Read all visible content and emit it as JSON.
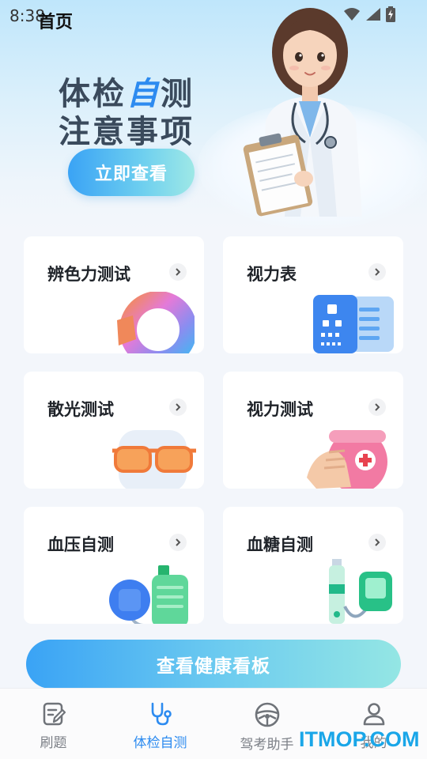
{
  "status_bar": {
    "time": "8:38"
  },
  "header": {
    "title": "首页"
  },
  "hero": {
    "title_line1_pre": "体检",
    "title_line1_accent": "自",
    "title_line1_post": "测",
    "title_line2": "注意事项",
    "cta_label": "立即查看"
  },
  "cards": [
    {
      "title": "辨色力测试",
      "illustration": "color-ring-icon"
    },
    {
      "title": "视力表",
      "illustration": "eye-chart-icon"
    },
    {
      "title": "散光测试",
      "illustration": "glasses-icon"
    },
    {
      "title": "视力测试",
      "illustration": "eye-cover-icon"
    },
    {
      "title": "血压自测",
      "illustration": "blood-pressure-icon"
    },
    {
      "title": "血糖自测",
      "illustration": "glucose-meter-icon"
    }
  ],
  "dashboard_button": {
    "label": "查看健康看板"
  },
  "bottom_nav": {
    "items": [
      {
        "label": "刷题",
        "icon": "edit-note-icon",
        "active": false
      },
      {
        "label": "体检自测",
        "icon": "stethoscope-icon",
        "active": true
      },
      {
        "label": "驾考助手",
        "icon": "steering-wheel-icon",
        "active": false
      },
      {
        "label": "我的",
        "icon": "user-icon",
        "active": false
      }
    ]
  },
  "watermark": "ITMOP.COM",
  "colors": {
    "accent": "#2d8bf0",
    "cta_start": "#3aa3f5",
    "cta_end": "#9ee8e6"
  }
}
